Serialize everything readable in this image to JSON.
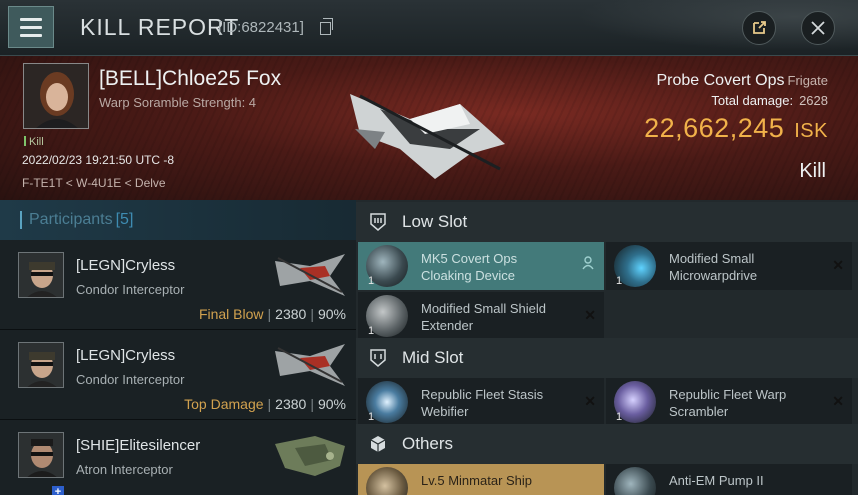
{
  "header": {
    "title": "KILL REPORT",
    "report_id": "[ID:6822431]"
  },
  "victim": {
    "name": "[BELL]Chloe25 Fox",
    "warp_scramble": "Warp Soramble Strength: 4",
    "kill_tag": "Kill",
    "datetime": "2022/02/23 19:21:50 UTC -8",
    "location": "F-TE1T < W-4U1E < Delve",
    "ship_name": "Probe Covert Ops",
    "ship_class": "Frigate",
    "total_damage_label": "Total damage:",
    "total_damage": "2628",
    "isk_value": "22,662,245",
    "isk_unit": "ISK",
    "result": "Kill"
  },
  "participants": {
    "label": "Participants",
    "count": "[5]",
    "rows": [
      {
        "name": "[LEGN]Cryless",
        "ship": "Condor Interceptor",
        "role": "Final Blow",
        "damage": "2380",
        "percent": "90%"
      },
      {
        "name": "[LEGN]Cryless",
        "ship": "Condor Interceptor",
        "role": "Top Damage",
        "damage": "2380",
        "percent": "90%"
      },
      {
        "name": "[SHIE]Elitesilencer",
        "ship": "Atron Interceptor",
        "role": "",
        "damage": "",
        "percent": ""
      }
    ]
  },
  "fitting": {
    "low_slot": {
      "label": "Low Slot",
      "items": [
        {
          "name": "MK5 Covert Ops Cloaking Device",
          "qty": "1"
        },
        {
          "name": "Modified Small Microwarpdrive",
          "qty": "1"
        },
        {
          "name": "Modified Small Shield Extender",
          "qty": "1"
        }
      ]
    },
    "mid_slot": {
      "label": "Mid Slot",
      "items": [
        {
          "name": "Republic Fleet Stasis Webifier",
          "qty": "1"
        },
        {
          "name": "Republic Fleet Warp Scrambler",
          "qty": "1"
        }
      ]
    },
    "others": {
      "label": "Others",
      "items": [
        {
          "name": "Lv.5 Minmatar Ship",
          "qty": ""
        },
        {
          "name": "Anti-EM Pump II",
          "qty": ""
        }
      ]
    }
  },
  "colors": {
    "isk": "#f1b24a",
    "role_highlight": "#d2a24f",
    "participants_accent": "#3e8cb2",
    "highlight_item": "#437a7a"
  }
}
